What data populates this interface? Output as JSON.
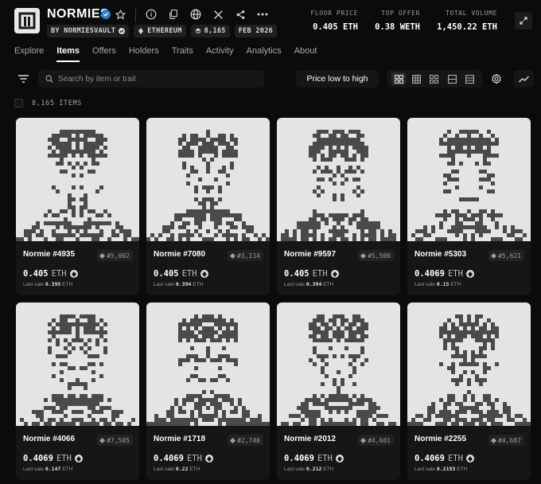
{
  "collection": {
    "name": "NORMIES",
    "creator": "BY NORMIESVAULT",
    "chain": "ETHEREUM",
    "supply": "8,165",
    "date": "FEB 2026"
  },
  "stats": [
    {
      "label": "FLOOR PRICE",
      "value": "0.405 ETH"
    },
    {
      "label": "TOP OFFER",
      "value": "0.38 WETH"
    },
    {
      "label": "TOTAL VOLUME",
      "value": "1,450.22 ETH"
    }
  ],
  "header_icons": [
    "star-icon",
    "info-icon",
    "copy-icon",
    "globe-icon",
    "x-icon",
    "share-icon",
    "more-icon"
  ],
  "tabs": [
    "Explore",
    "Items",
    "Offers",
    "Holders",
    "Traits",
    "Activity",
    "Analytics",
    "About"
  ],
  "active_tab": "Items",
  "toolbar": {
    "search_placeholder": "Search by item or trait",
    "sort_label": "Price low to high"
  },
  "item_count": "8,165 ITEMS",
  "colors": {
    "background": "#0b0b0b",
    "card": "#161616",
    "art_bg": "#e3e5e4",
    "pixel": "#4a4a4a",
    "accent": "#2081e2"
  },
  "items": [
    {
      "name": "Normie #4935",
      "rank": "#5,002",
      "price": "0.405",
      "currency": "ETH",
      "last_sale_label": "Last sale",
      "last_sale": "0.395",
      "last_sale_currency": "ETH"
    },
    {
      "name": "Normie #7080",
      "rank": "#3,114",
      "price": "0.405",
      "currency": "ETH",
      "last_sale_label": "Last sale",
      "last_sale": "0.394",
      "last_sale_currency": "ETH"
    },
    {
      "name": "Normie #9597",
      "rank": "#5,500",
      "price": "0.405",
      "currency": "ETH",
      "last_sale_label": "Last sale",
      "last_sale": "0.394",
      "last_sale_currency": "ETH"
    },
    {
      "name": "Normie #5303",
      "rank": "#5,621",
      "price": "0.4069",
      "currency": "ETH",
      "last_sale_label": "Last sale",
      "last_sale": "0.15",
      "last_sale_currency": "ETH"
    },
    {
      "name": "Normie #4066",
      "rank": "#7,585",
      "price": "0.4069",
      "currency": "ETH",
      "last_sale_label": "Last sale",
      "last_sale": "0.147",
      "last_sale_currency": "ETH"
    },
    {
      "name": "Normie #1718",
      "rank": "#2,740",
      "price": "0.4069",
      "currency": "ETH",
      "last_sale_label": "Last sale",
      "last_sale": "0.22",
      "last_sale_currency": "ETH"
    },
    {
      "name": "Normie #2012",
      "rank": "#4,601",
      "price": "0.4069",
      "currency": "ETH",
      "last_sale_label": "Last sale",
      "last_sale": "0.212",
      "last_sale_currency": "ETH"
    },
    {
      "name": "Normie #2255",
      "rank": "#4,687",
      "price": "0.4069",
      "currency": "ETH",
      "last_sale_label": "Last sale",
      "last_sale": "0.2193",
      "last_sale_currency": "ETH"
    }
  ]
}
